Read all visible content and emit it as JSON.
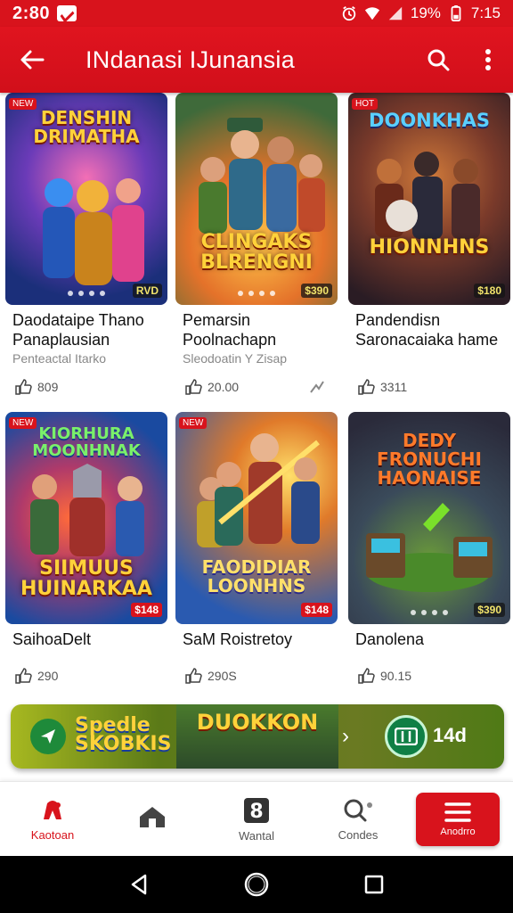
{
  "status_bar": {
    "time": "2:80",
    "battery_text": "19%",
    "right_time": "7:15"
  },
  "app_bar": {
    "title": "INdanasi IJunansia"
  },
  "cards": [
    {
      "art_title": "DENSHIN DRIMATHA",
      "title": "Daodataipe Thano",
      "title2": "Panaplausian",
      "sub": "Penteactal Itarko",
      "likes": "809",
      "price": "RVD"
    },
    {
      "art_title": "CLINGAKS BLRENGNI",
      "title": "Pemarsin",
      "title2": "Poolnachapn",
      "sub": "Sleodoatin Y Zisap",
      "likes": "20.00",
      "price": "$390"
    },
    {
      "art_title": "DOONKHAS",
      "art_title2": "HIONNHNS",
      "title": "Pandendisn",
      "title2": "Saronacaiaka hame",
      "sub": "",
      "likes": "3311",
      "price": "$180"
    },
    {
      "art_title": "KIORHURA MOONHNAK",
      "art_title2": "SIIMUUS HUINARKAA",
      "title": "SaihoaDelt",
      "title2": "",
      "sub": "",
      "likes": "290",
      "price": "$148"
    },
    {
      "art_title": "FAODIDIAR LOONHNS",
      "title": "SaM Roistretoy",
      "title2": "",
      "sub": "",
      "likes": "290S",
      "price": "$148"
    },
    {
      "art_title": "DEDY FRONUCHI HAONAISE",
      "title": "Danolena",
      "title2": "",
      "sub": "",
      "likes": "90.15",
      "price": "$390"
    }
  ],
  "banner": {
    "brand_line1": "Spedle",
    "brand_line2": "SKOBKIS",
    "image_title": "DUOKKON",
    "cta_text": "14d"
  },
  "bottom_nav": {
    "items": [
      {
        "label": "Kaotoan",
        "icon": "app-logo-icon"
      },
      {
        "label": "",
        "icon": "home-icon"
      },
      {
        "label": "Wantal",
        "icon": "number-eight-icon"
      },
      {
        "label": "Condes",
        "icon": "search-icon"
      }
    ],
    "cta_label": "Anodrro"
  },
  "colors": {
    "brand_red": "#d8131c",
    "banner_green": "#5b7a18"
  }
}
